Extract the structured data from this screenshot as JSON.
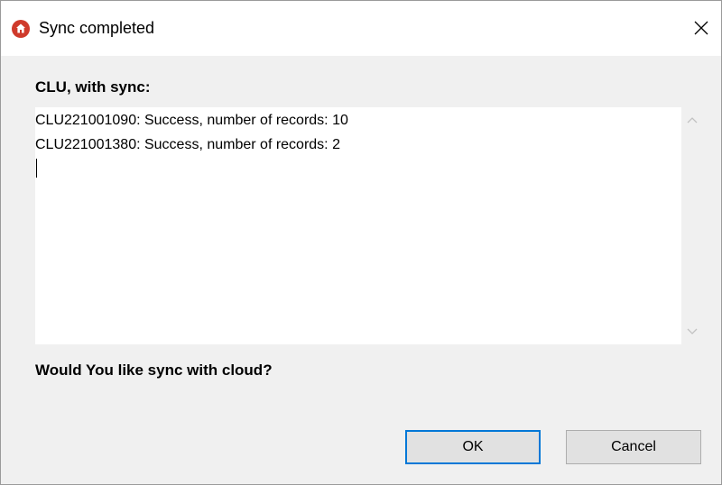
{
  "window": {
    "title": "Sync completed",
    "icon": "home-icon",
    "close_icon": "close-icon"
  },
  "content": {
    "section_label": "CLU, with sync:",
    "log_lines": [
      "CLU221001090: Success, number of records: 10",
      "CLU221001380: Success, number of records: 2"
    ],
    "question": "Would You like sync with cloud?"
  },
  "buttons": {
    "ok_label": "OK",
    "cancel_label": "Cancel"
  },
  "colors": {
    "icon_red": "#cf3a2b",
    "focus_blue": "#0078d7"
  }
}
